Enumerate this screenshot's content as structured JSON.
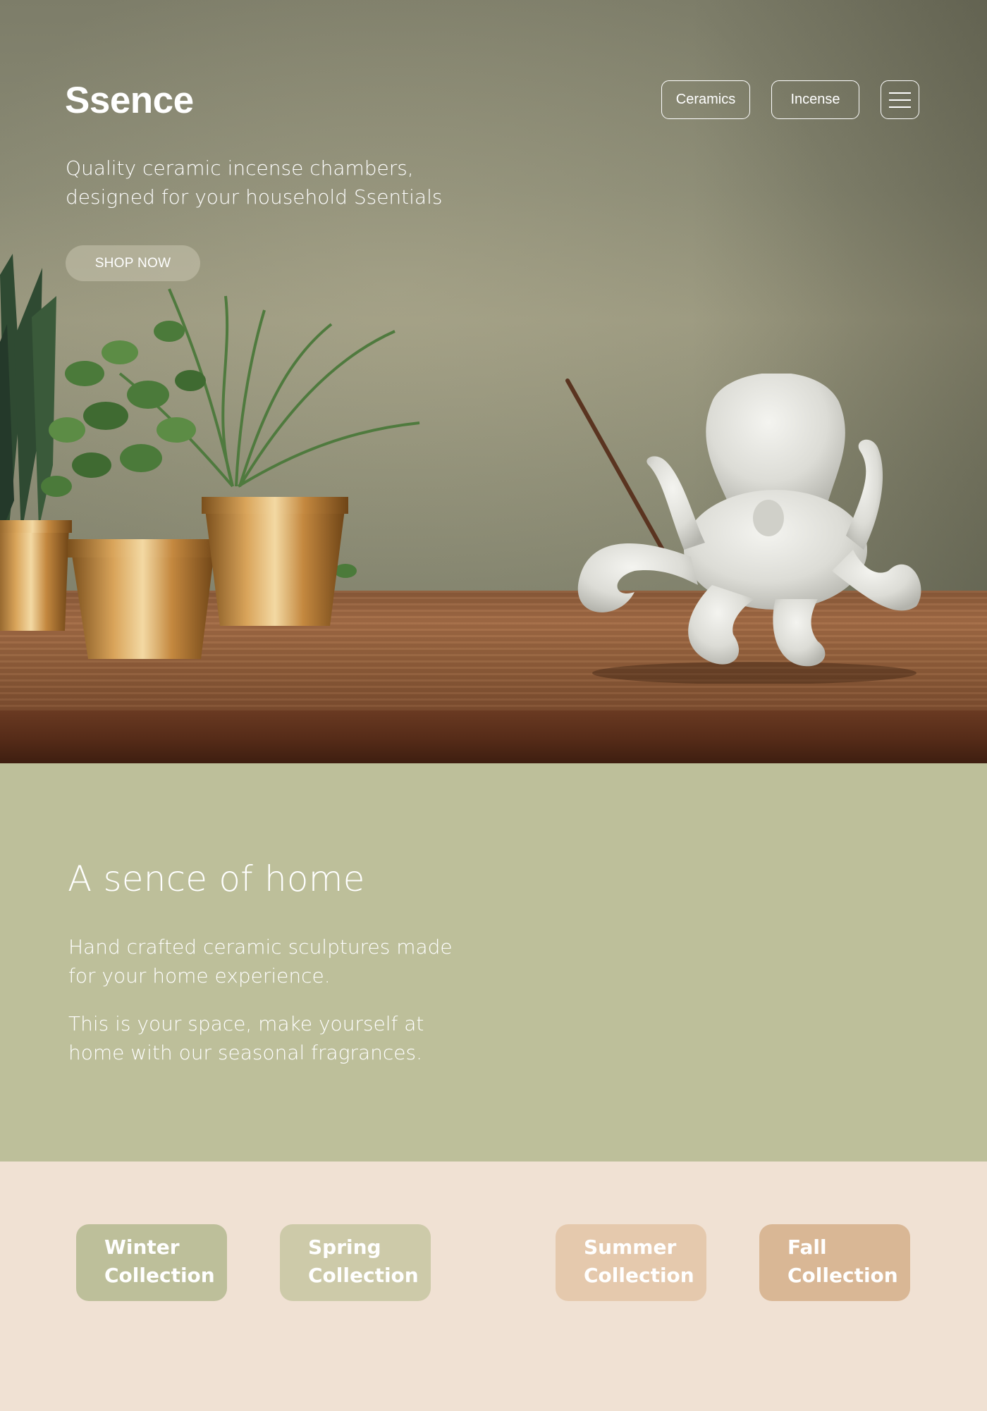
{
  "header": {
    "brand": "Ssence",
    "tagline": "Quality ceramic incense chambers, designed for your household Ssentials",
    "cta_label": "SHOP NOW",
    "nav": {
      "ceramics_label": "Ceramics",
      "incense_label": "Incense",
      "menu_icon": "hamburger-menu-icon"
    }
  },
  "about": {
    "heading": "A sence of home",
    "paragraph_1": "Hand crafted ceramic sculptures made for your home experience.",
    "paragraph_2": "This is your space, make yourself at home with our seasonal fragrances."
  },
  "collections": [
    {
      "line1": "Winter",
      "line2": "Collection",
      "color": "#bdbf9a"
    },
    {
      "line1": "Spring",
      "line2": "Collection",
      "color": "#cdcaa9"
    },
    {
      "line1": "Summer",
      "line2": "Collection",
      "color": "#e5c9ad"
    },
    {
      "line1": "Fall",
      "line2": "Collection",
      "color": "#d9b795"
    }
  ],
  "colors": {
    "hero_wall": "#8a8a74",
    "table_wood": "#93603c",
    "about_bg": "#bdbf9a",
    "collections_bg": "#f0e1d3",
    "text": "#ffffff"
  }
}
